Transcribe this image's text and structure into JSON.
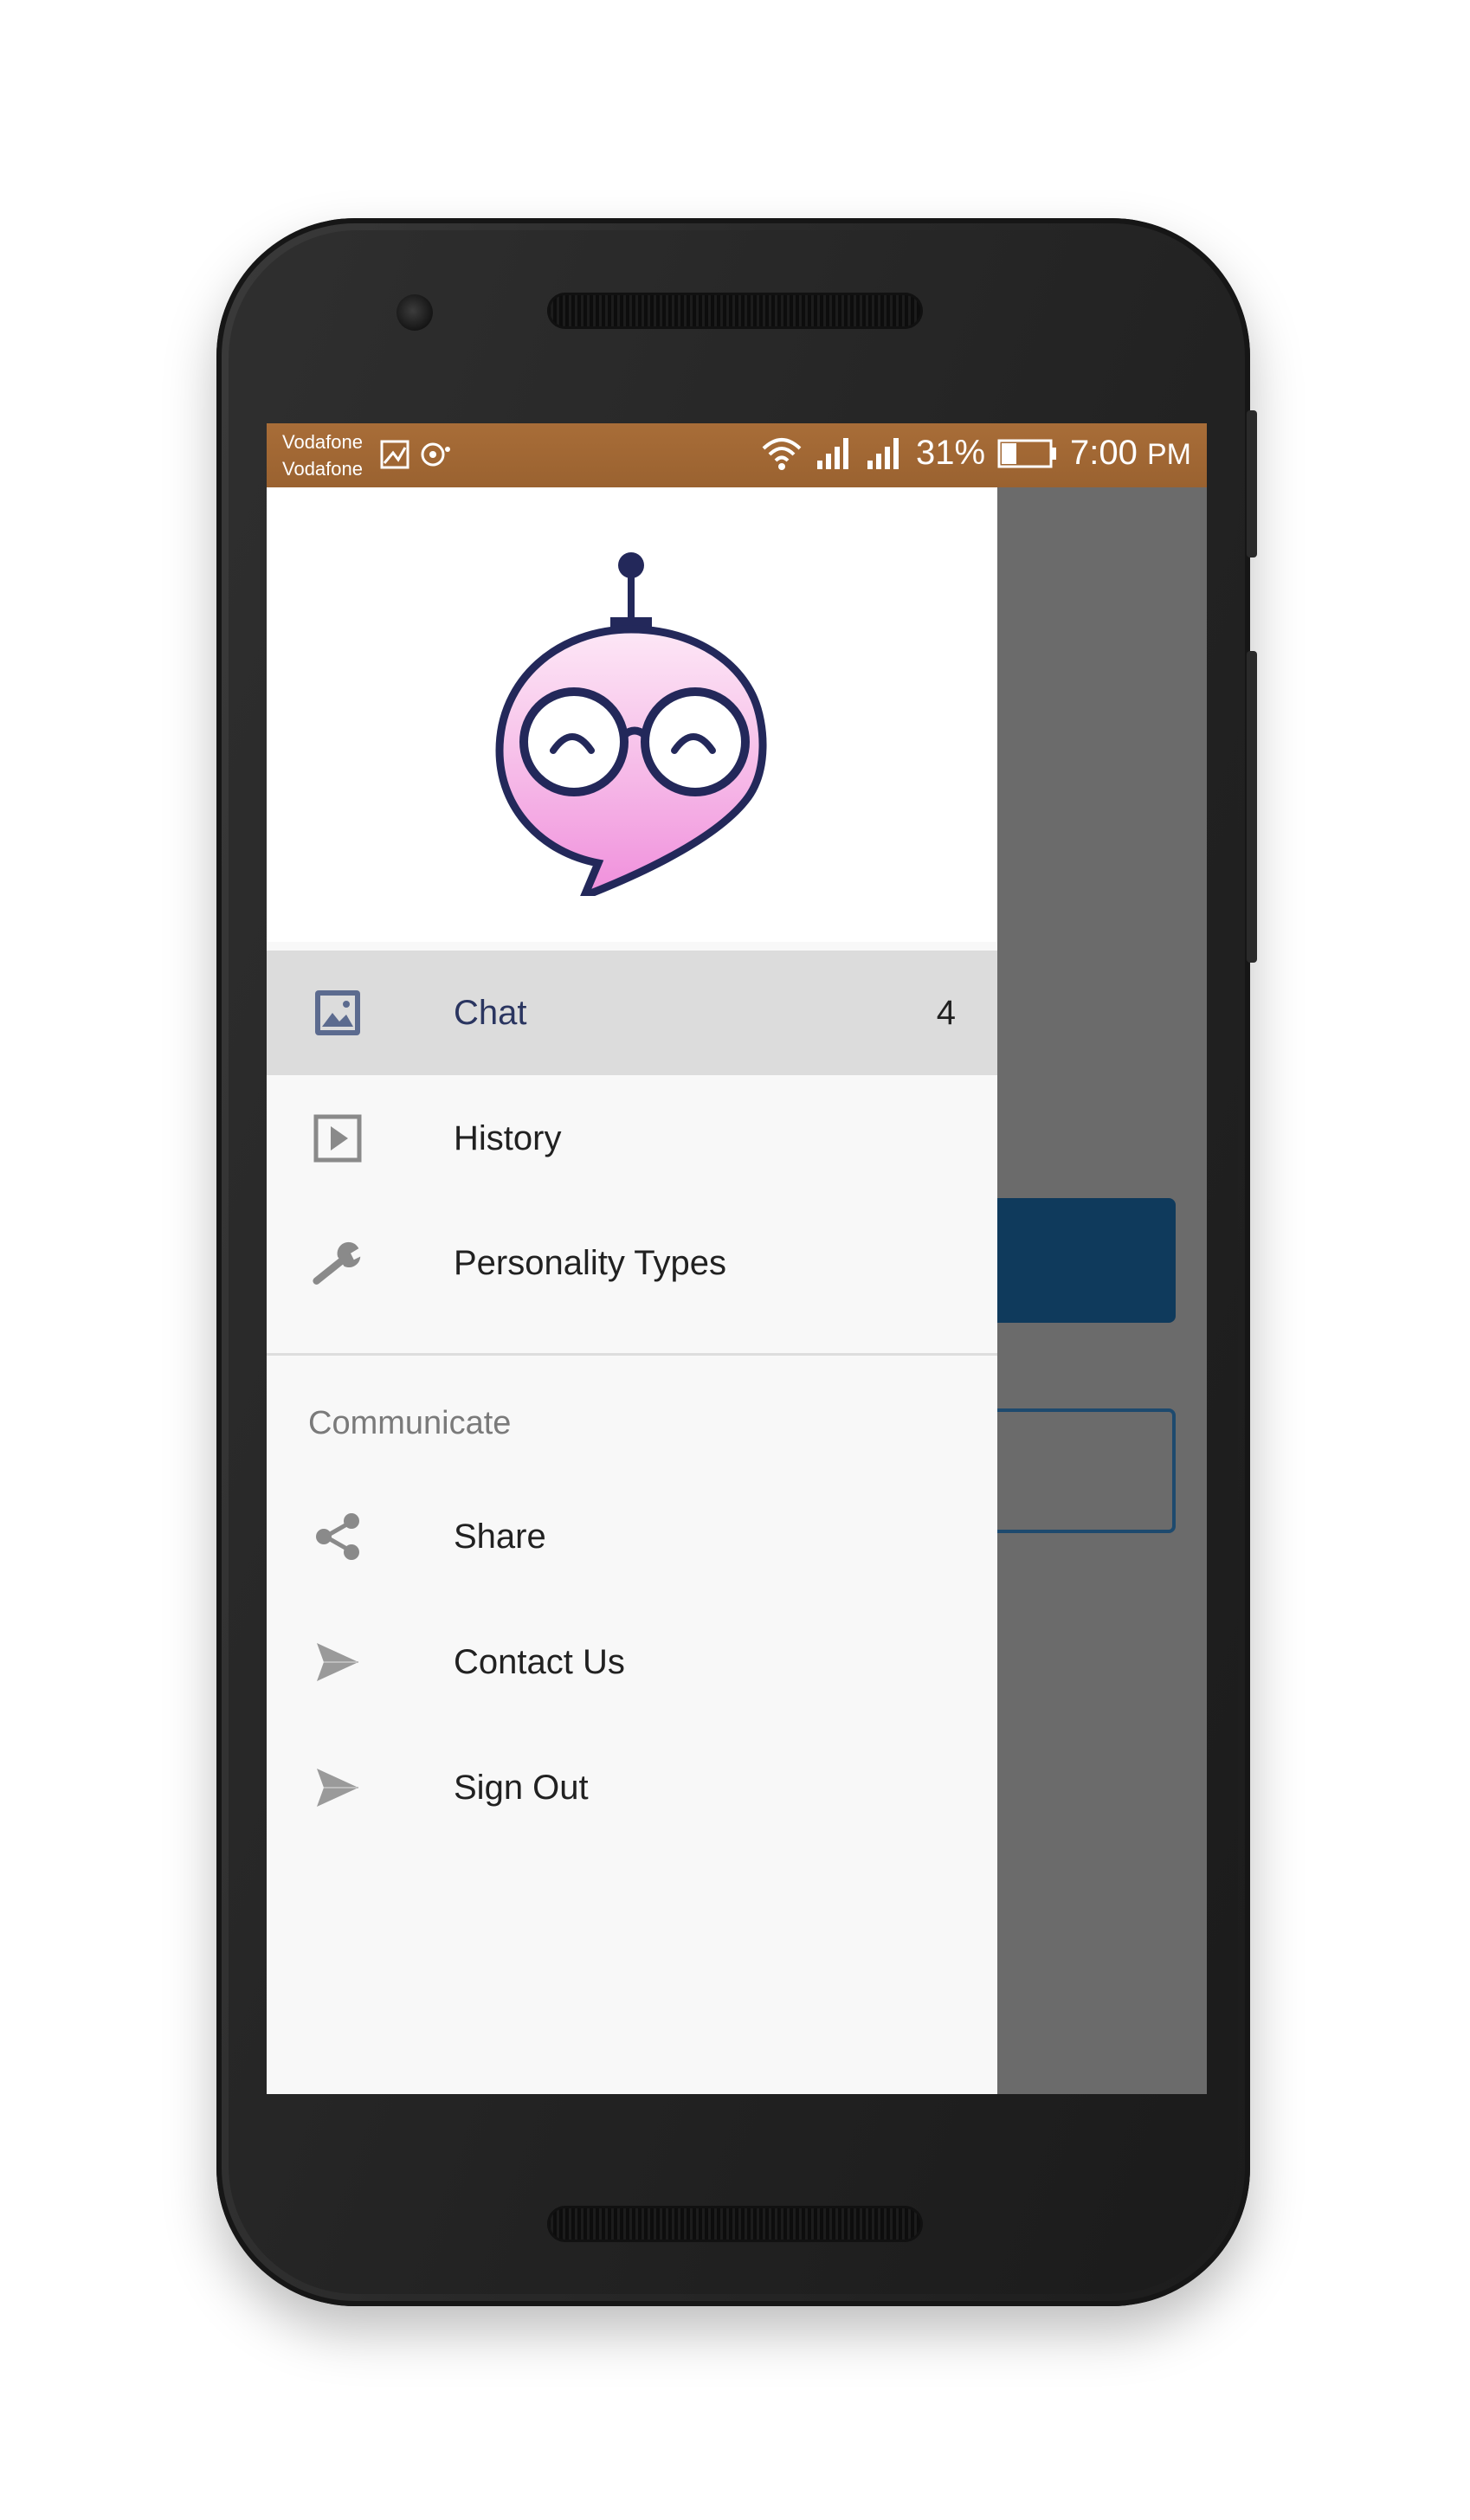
{
  "status_bar": {
    "carrier_1": "Vodafone",
    "carrier_2": "Vodafone",
    "battery_percent": "31%",
    "battery_level": 0.31,
    "time": "7:00",
    "time_suffix": "PM",
    "icons": [
      "gallery-icon",
      "notification-icon",
      "wifi-icon",
      "signal-icon",
      "signal-icon",
      "battery-icon"
    ]
  },
  "drawer": {
    "logo": "robot-chat-logo",
    "items": [
      {
        "label": "Chat",
        "count": "4",
        "icon": "image-icon",
        "active": true
      },
      {
        "label": "History",
        "icon": "play-icon",
        "active": false
      },
      {
        "label": "Personality Types",
        "icon": "wrench-icon",
        "active": false
      }
    ],
    "section_title": "Communicate",
    "communicate_items": [
      {
        "label": "Share",
        "icon": "share-icon"
      },
      {
        "label": "Contact Us",
        "icon": "send-icon"
      },
      {
        "label": "Sign Out",
        "icon": "send-icon"
      }
    ]
  },
  "colors": {
    "status_bar": "#a86d38",
    "active_item_bg": "#dcdcdc",
    "active_item_text": "#2a3560",
    "primary_button": "#0f3a5c",
    "scrim": "#6b6b6b"
  }
}
